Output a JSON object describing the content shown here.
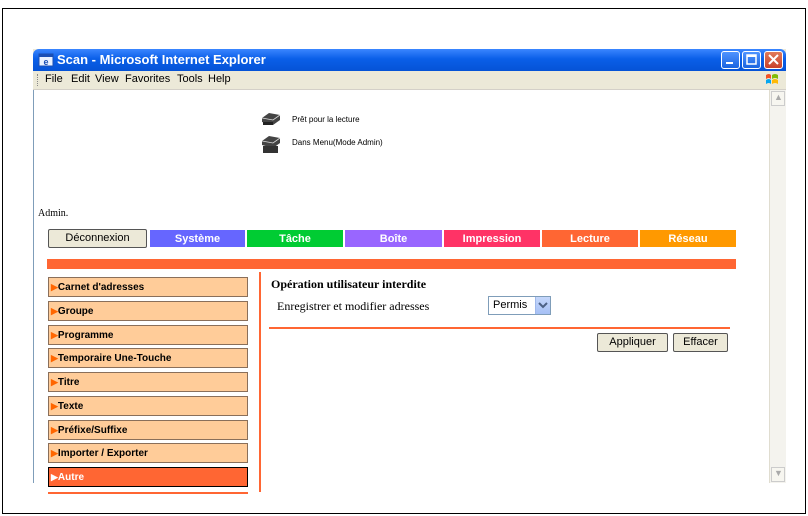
{
  "window": {
    "title": "Scan - Microsoft Internet Explorer"
  },
  "menu": [
    "File",
    "Edit",
    "View",
    "Favorites",
    "Tools",
    "Help"
  ],
  "status": {
    "line1": "Prêt pour la lecture",
    "line2": "Dans Menu(Mode Admin)"
  },
  "user": "Admin.",
  "tabs": [
    {
      "label": "Système",
      "color": "#6666ff"
    },
    {
      "label": "Tâche",
      "color": "#00cc33"
    },
    {
      "label": "Boîte",
      "color": "#9966ff"
    },
    {
      "label": "Impression",
      "color": "#ff3366"
    },
    {
      "label": "Lecture",
      "color": "#ff6633"
    },
    {
      "label": "Réseau",
      "color": "#ff9900"
    }
  ],
  "logout_label": "Déconnexion",
  "sidebar": [
    {
      "label": "Carnet d'adresses"
    },
    {
      "label": "Groupe"
    },
    {
      "label": "Programme"
    },
    {
      "label": "Temporaire Une-Touche"
    },
    {
      "label": "Titre"
    },
    {
      "label": "Texte"
    },
    {
      "label": "Préfixe/Suffixe"
    },
    {
      "label": "Importer / Exporter"
    },
    {
      "label": "Autre",
      "active": true
    }
  ],
  "main": {
    "section_title": "Opération utilisateur interdite",
    "field_label": "Enregistrer et modifier adresses",
    "field_value": "Permis",
    "apply_label": "Appliquer",
    "clear_label": "Effacer"
  },
  "colors": {
    "accent": "#ff6633",
    "sidebar_bg": "#ffcc99",
    "titlebar": "#0a5fe8"
  },
  "icons": {
    "printer": "printer-icon",
    "dropdown": "chevron-down-icon",
    "browser": "ie-icon"
  }
}
